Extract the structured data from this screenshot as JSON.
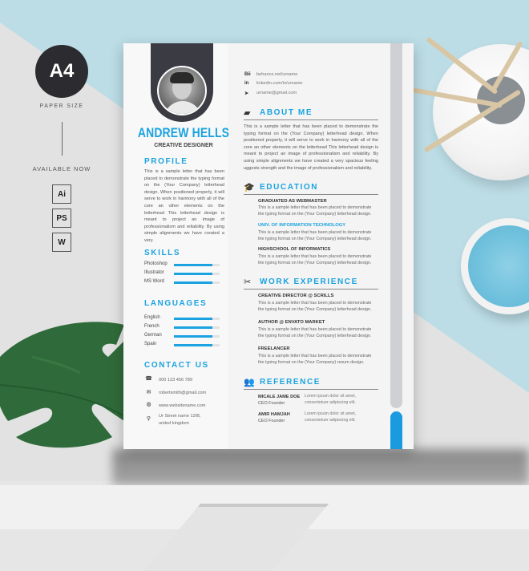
{
  "promo": {
    "paper_badge": "A4",
    "paper_label": "PAPER SIZE",
    "available_label": "AVAILABLE NOW",
    "formats": [
      "Ai",
      "PS",
      "W"
    ]
  },
  "colors": {
    "accent": "#1aa3e0",
    "dark_tab": "#3a3b43",
    "background_blue": "#bcdde6"
  },
  "resume": {
    "name": "ANDREW HELLS",
    "role": "CREATIVE DESIGNER",
    "profile": {
      "heading": "PROFILE",
      "text": "This is a sample letter that has been placed to demonstrate the typing format on the (Your Company) letterhead design. When positioned properly, it will serve to work in harmony with all of the core an other elements on the letterhead This letterhead design is meant to project an image of professionalism and reliability. By using simple alignments we have created a very."
    },
    "skills": {
      "heading": "SKILLS",
      "items": [
        {
          "label": "Photoshop",
          "level": 0.85
        },
        {
          "label": "Illustrator",
          "level": 0.85
        },
        {
          "label": "MS Word",
          "level": 0.85
        }
      ]
    },
    "languages": {
      "heading": "LANGUAGES",
      "items": [
        {
          "label": "English",
          "level": 0.85
        },
        {
          "label": "French",
          "level": 0.85
        },
        {
          "label": "German",
          "level": 0.85
        },
        {
          "label": "Spain",
          "level": 0.85
        }
      ]
    },
    "contact": {
      "heading": "CONTACT US",
      "items": [
        {
          "icon": "phone-icon",
          "glyph": "☎",
          "text": "000 123 456 789"
        },
        {
          "icon": "mail-icon",
          "glyph": "✉",
          "text": "robertsmith@gmail.com"
        },
        {
          "icon": "globe-icon",
          "glyph": "◍",
          "text": "www.websitename.com"
        },
        {
          "icon": "location-pin-icon",
          "glyph": "⚲",
          "text": "Ur Street name 12/B,"
        },
        {
          "icon": "",
          "glyph": "",
          "text": "united kingdom"
        }
      ]
    },
    "social": [
      {
        "icon": "behance-icon",
        "glyph": "Bē",
        "text": "behance.net/urname"
      },
      {
        "icon": "linkedin-icon",
        "glyph": "in",
        "text": "linkedin.com/in/urname"
      },
      {
        "icon": "send-icon",
        "glyph": "➤",
        "text": "urname@gmail.com"
      }
    ],
    "about": {
      "heading": "ABOUT ME",
      "icon_glyph": "▰",
      "text": "This is a sample letter that has been placed to demonstrate the typing format on the (Your Company) letterhead design. When positioned properly, it will serve to work in harmony with all of the core an other elements on the letterhead This letterhead design is meant to project an image of professionalism and reliability. By using simple alignments we have created a very spacious feeling uggests strength and the image of professionalism and reliability."
    },
    "education": {
      "heading": "EDUCATION",
      "icon_glyph": "🎓",
      "items": [
        {
          "title": "GRADUATED AS WEBMASTER",
          "desc": "This is a sample letter that has been placed to demonstrate the typing format on the (Your Company) letterhead design."
        },
        {
          "title": "UNIV. OF INFORMATION TECHNOLOGY",
          "desc": "This is a sample letter that has been placed to demonstrate the typing format on the (Your Company) letterhead design."
        },
        {
          "title": "HIGHSCHOOL OF INFORMATICS",
          "desc": "This is a sample letter that has been placed to demonstrate the typing format on the (Your Company) letterhead design."
        }
      ]
    },
    "work": {
      "heading": "WORK EXPERIENCE",
      "icon_glyph": "✂",
      "items": [
        {
          "title": "CREATIVE DIRECTOR @ SCRILLS",
          "desc": "This is a sample letter that has been placed to demonstrate the typing format on the (Your Company) letterhead design."
        },
        {
          "title": "AUTHOR @ ENVATO MARKET",
          "desc": "This is a sample letter that has been placed to demonstrate the typing format on the (Your Company) letterhead design."
        },
        {
          "title": "FREELANCER",
          "desc": "This is a sample letter that has been placed to demonstrate the typing format on the (Your Company) resum design."
        }
      ]
    },
    "reference": {
      "heading": "REFERENCE",
      "icon_glyph": "👥",
      "items": [
        {
          "name": "MICALE JAME DOE",
          "role": "CEO Founder",
          "text": "Lorem ipsum dolor sit amet, consectetuer adipiscing elit."
        },
        {
          "name": "AMIR HAMJAH",
          "role": "CEO Founder",
          "text": "Lorem ipsum dolor sit amet, consectetuer adipiscing elit."
        }
      ]
    }
  }
}
